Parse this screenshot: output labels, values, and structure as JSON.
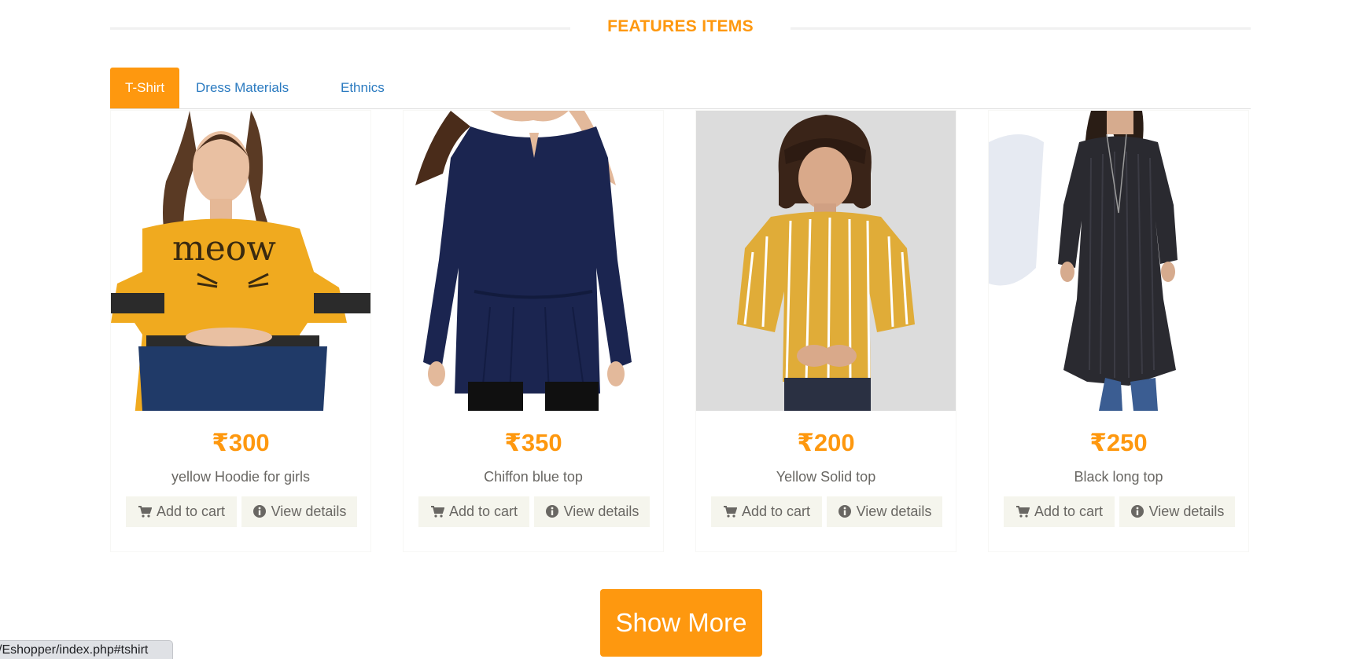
{
  "section": {
    "title": "FEATURES ITEMS"
  },
  "tabs": [
    {
      "label": "T-Shirt",
      "active": true
    },
    {
      "label": "Dress Materials",
      "active": false
    },
    {
      "label": "Ethnics",
      "active": false
    }
  ],
  "products": [
    {
      "price": "₹300",
      "name": "yellow Hoodie for girls",
      "add_label": "Add to cart",
      "details_label": "View details"
    },
    {
      "price": "₹350",
      "name": "Chiffon blue top",
      "add_label": "Add to cart",
      "details_label": "View details"
    },
    {
      "price": "₹200",
      "name": "Yellow Solid top",
      "add_label": "Add to cart",
      "details_label": "View details"
    },
    {
      "price": "₹250",
      "name": "Black long top",
      "add_label": "Add to cart",
      "details_label": "View details"
    }
  ],
  "show_more": {
    "label": "Show More"
  },
  "status_bar": {
    "url": "/Eshopper/index.php#tshirt"
  },
  "colors": {
    "accent": "#fe980f",
    "link": "#2a7ac0",
    "button_bg": "#f5f5ed",
    "text": "#696763"
  },
  "icons": {
    "cart": "shopping-cart-icon",
    "details": "info-circle-icon"
  }
}
